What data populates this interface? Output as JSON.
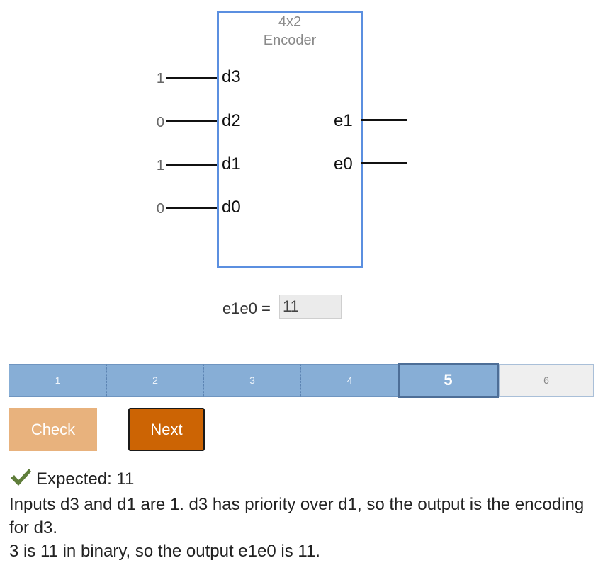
{
  "encoder": {
    "title_line1": "4x2",
    "title_line2": "Encoder",
    "inputs": [
      {
        "value": "1",
        "pin": "d3"
      },
      {
        "value": "0",
        "pin": "d2"
      },
      {
        "value": "1",
        "pin": "d1"
      },
      {
        "value": "0",
        "pin": "d0"
      }
    ],
    "outputs": [
      {
        "pin": "e1"
      },
      {
        "pin": "e0"
      }
    ]
  },
  "answer": {
    "label": "e1e0 =",
    "value": "11"
  },
  "progress": {
    "steps": [
      "1",
      "2",
      "3",
      "4",
      "5",
      "6"
    ],
    "current": "5"
  },
  "buttons": {
    "check": "Check",
    "next": "Next"
  },
  "feedback": {
    "expected": "Expected: 11",
    "line1": "Inputs d3 and d1 are 1. d3 has priority over d1, so the output is the encoding",
    "line2": "for d3.",
    "line3": "3 is 11 in binary, so the output e1e0 is 11."
  },
  "colors": {
    "box_border": "#5b8fe0",
    "progress_done": "#87aed6",
    "check_button": "#e8b27d",
    "next_button": "#cc6404",
    "checkmark": "#5f7d3a"
  }
}
